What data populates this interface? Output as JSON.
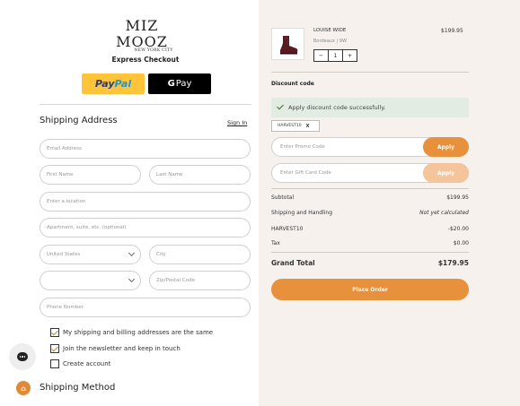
{
  "brand": {
    "name": "MIZ MOOZ",
    "tagline": "NEW YORK CITY"
  },
  "express": {
    "title": "Express Checkout",
    "paypal_part1": "Pay",
    "paypal_part2": "Pal",
    "gpay_g": "G",
    "gpay_label": "Pay"
  },
  "shipping": {
    "title": "Shipping Address",
    "signin": "Sign In",
    "fields": {
      "email": "Email Address",
      "first_name": "First Name",
      "last_name": "Last Name",
      "location": "Enter a location",
      "apartment": "Apartment, suite, etc. (optional)",
      "country": "United States",
      "city": "City",
      "state": "",
      "zip": "Zip/Postal Code",
      "phone": "Phone Number"
    },
    "checkboxes": [
      {
        "label": "My shipping and billing addresses are the same",
        "checked": true
      },
      {
        "label": "Join the newsletter and keep in touch",
        "checked": true
      },
      {
        "label": "Create account",
        "checked": false
      }
    ]
  },
  "method": {
    "title": "Shipping Method"
  },
  "product": {
    "name": "LOUISE WIDE",
    "variant": "Bordeaux | 9W",
    "price": "$199.95",
    "qty": "1",
    "minus": "−",
    "plus": "+"
  },
  "discount": {
    "label": "Discount code",
    "success": "Apply discount code successfully.",
    "applied_code": "HARVEST10",
    "remove": "X",
    "promo_placeholder": "Enter Promo Code",
    "gift_placeholder": "Enter Gift Card Code",
    "apply": "Apply"
  },
  "summary": {
    "rows": [
      {
        "label": "Subtotal",
        "value": "$199.95"
      },
      {
        "label": "Shipping and Handling",
        "value": "Not yet calculated"
      },
      {
        "label": "HARVEST10",
        "value": "-$20.00"
      },
      {
        "label": "Tax",
        "value": "$0.00"
      }
    ],
    "grand_label": "Grand Total",
    "grand_value": "$179.95"
  },
  "place_order": "Place Order",
  "colors": {
    "accent": "#e8913d",
    "accent_disabled": "#f4c49a",
    "right_panel": "#f6f1ec",
    "success_bg": "#e3ece2",
    "paypal_yellow": "#ffc43a"
  },
  "icons": {
    "chat": "chat-bubble-icon",
    "shipping_method": "shipping-icon",
    "success": "checkmark-icon"
  }
}
